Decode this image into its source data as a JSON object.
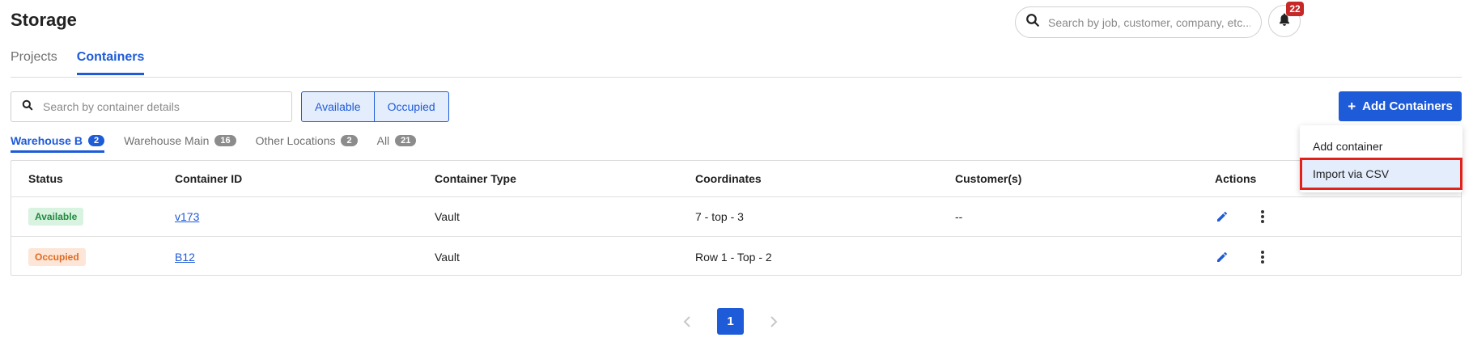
{
  "header": {
    "title": "Storage",
    "search_placeholder": "Search by job, customer, company, etc...",
    "notification_count": "22"
  },
  "top_tabs": [
    {
      "label": "Projects",
      "active": false
    },
    {
      "label": "Containers",
      "active": true
    }
  ],
  "toolbar": {
    "search_placeholder": "Search by container details",
    "filters": [
      "Available",
      "Occupied"
    ],
    "add_button_label": "Add Containers"
  },
  "location_tabs": [
    {
      "label": "Warehouse B",
      "count": "2",
      "active": true
    },
    {
      "label": "Warehouse Main",
      "count": "16",
      "active": false
    },
    {
      "label": "Other Locations",
      "count": "2",
      "active": false
    },
    {
      "label": "All",
      "count": "21",
      "active": false
    }
  ],
  "table": {
    "columns": [
      "Status",
      "Container ID",
      "Container Type",
      "Coordinates",
      "Customer(s)",
      "Actions"
    ],
    "rows": [
      {
        "status": "Available",
        "container_id": "v173",
        "type": "Vault",
        "coordinates": "7 - top - 3",
        "customers": "--"
      },
      {
        "status": "Occupied",
        "container_id": "B12",
        "type": "Vault",
        "coordinates": "Row 1 - Top - 2",
        "customers": ""
      }
    ]
  },
  "dropdown": {
    "items": [
      "Add container",
      "Import via CSV"
    ],
    "highlighted_index": 1
  },
  "pagination": {
    "current_page": "1"
  },
  "colors": {
    "accent": "#1e5bd8",
    "badge_red": "#c62828",
    "available_bg": "#d9f3e1",
    "available_text": "#1f8a3d",
    "occupied_bg": "#fde6d8",
    "occupied_text": "#e06a1f",
    "highlight_border": "#e3211b"
  },
  "icons": [
    "search-icon",
    "bell-icon",
    "plus-icon",
    "edit-icon",
    "more-vertical-icon",
    "chevron-left-icon",
    "chevron-right-icon"
  ]
}
